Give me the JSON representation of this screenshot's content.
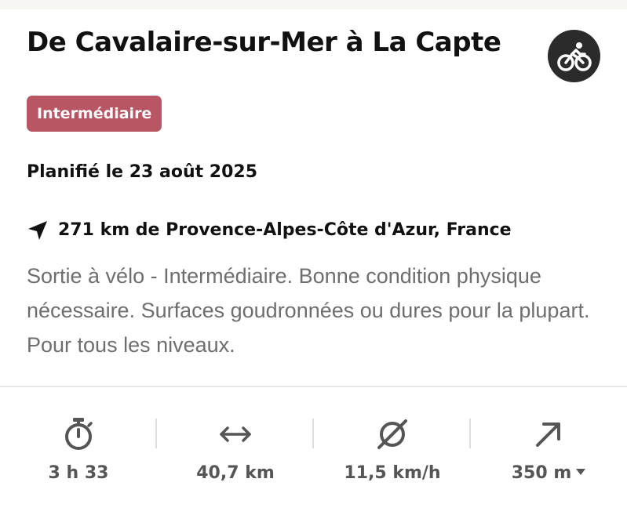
{
  "route": {
    "title": "De Cavalaire-sur-Mer à La Capte",
    "activity_icon": "bicycle-icon",
    "difficulty_badge": "Intermédiaire",
    "planned_date": "Planifié le 23 août 2025",
    "location_icon": "navigation-arrow-icon",
    "location": "271 km de Provence-Alpes-Côte d'Azur, France",
    "description": "Sortie à vélo - Intermédiaire. Bonne condition physique nécessaire. Surfaces goudronnées ou dures pour la plupart. Pour tous les niveaux."
  },
  "stats": {
    "duration": {
      "icon": "stopwatch-icon",
      "value": "3 h 33"
    },
    "distance": {
      "icon": "horizontal-arrows-icon",
      "value": "40,7 km"
    },
    "speed": {
      "icon": "average-diameter-icon",
      "value": "11,5 km/h"
    },
    "elevation": {
      "icon": "diagonal-up-arrow-icon",
      "value": "350 m",
      "dropdown_icon": "caret-down-icon"
    }
  },
  "colors": {
    "badge_background": "#b85763",
    "activity_icon_background": "#2b2b2b",
    "description_text": "#6e6e6e",
    "stat_text": "#555555"
  }
}
